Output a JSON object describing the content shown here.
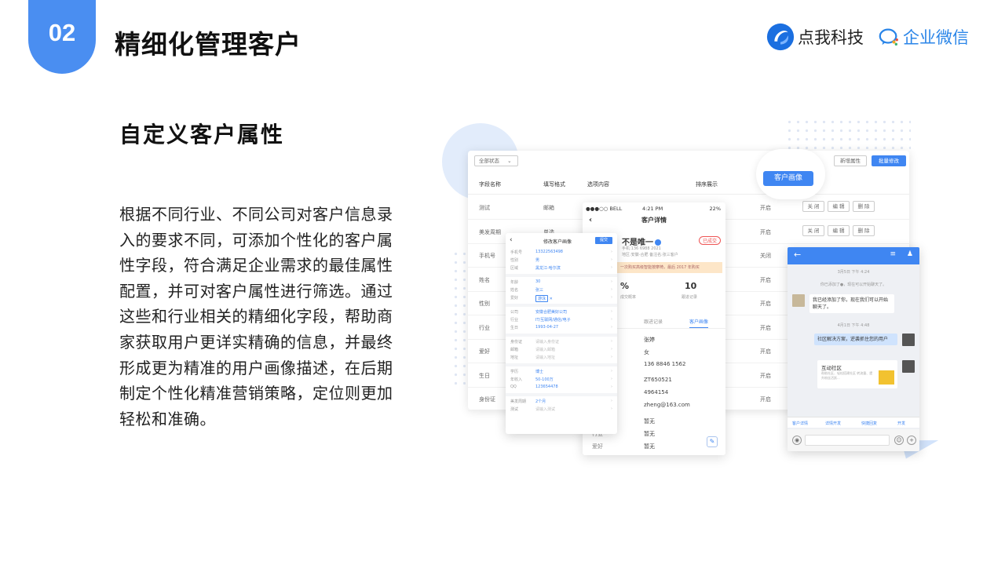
{
  "header": {
    "section_number": "02",
    "title": "精细化管理客户",
    "brand_name": "点我科技",
    "partner_name": "企业微信"
  },
  "content": {
    "subtitle": "自定义客户属性",
    "paragraph_lines": [
      "根据不同行业、不同公司对客户信息录",
      "入的要求不同，可添加个性化的客户属",
      "性字段，符合满足企业需求的最佳属性",
      "配置，并可对客户属性进行筛选。通过",
      "这些和行业相关的精细化字段，帮助商",
      "家获取用户更详实精确的信息，并最终",
      "形成更为精准的用户画像描述，在后期",
      "制定个性化精准营销策略，定位则更加",
      "轻松和准确。"
    ]
  },
  "table_panel": {
    "filter_select": "全部状态",
    "new_attr_button": "新增属性",
    "batch_edit_button": "批量修改",
    "columns": [
      "字段名称",
      "填写格式",
      "选项内容",
      "排序展示"
    ],
    "rows": [
      {
        "name": "测试",
        "format": "邮箱",
        "status": "开启",
        "actions": [
          "关 闭",
          "编 辑",
          "删 除"
        ]
      },
      {
        "name": "美发周期",
        "format": "单选",
        "status": "开启",
        "actions": [
          "关 闭",
          "编 辑",
          "删 除"
        ]
      },
      {
        "name": "手机号",
        "format": "",
        "status": "关闭",
        "actions": []
      },
      {
        "name": "姓名",
        "format": "",
        "status": "开启",
        "actions": []
      },
      {
        "name": "性别",
        "format": "",
        "status": "开启",
        "actions": []
      },
      {
        "name": "行业",
        "format": "",
        "status": "开启",
        "actions": []
      },
      {
        "name": "爱好",
        "format": "",
        "status": "开启",
        "actions": []
      },
      {
        "name": "生日",
        "format": "",
        "status": "开启",
        "actions": []
      },
      {
        "name": "身份证",
        "format": "",
        "status": "开启",
        "actions": []
      }
    ]
  },
  "portrait_bubble": {
    "label": "客户画像"
  },
  "phone_detail": {
    "carrier": "●●●○○ BELL",
    "time": "4:21 PM",
    "battery": "22%",
    "nav_title": "客户详情",
    "customer_name": "不是唯一",
    "tag": "已成交",
    "sub_line1": "手机:136 6988 2021",
    "sub_line2": "地区:安徽-合肥  备注名:张三客户",
    "note": "一次购买高级智能按摩椅，最后 2017 年购买",
    "stat1_value": "%",
    "stat1_label": "成交概率",
    "stat2_value": "10",
    "stat2_label": "跟进记录",
    "tab_follow": "跟进记录",
    "tab_portrait": "客户画像",
    "values": [
      "张婷",
      "女",
      "136 8846 1562",
      "ZT650521",
      "4964154",
      "zheng@163.com",
      "暂无",
      "暂无",
      "暂无"
    ],
    "tail_labels": [
      "",
      "",
      "",
      "",
      "",
      "",
      "",
      "行业",
      "爱好"
    ]
  },
  "edit_form": {
    "title": "修改客户画像",
    "submit": "提交",
    "sections": [
      [
        {
          "k": "手机号",
          "v": "13322563498"
        },
        {
          "k": "性别",
          "v": "男"
        },
        {
          "k": "区域",
          "v": "黑龙江-哈尔滨"
        }
      ],
      [
        {
          "k": "年龄",
          "v": "30"
        },
        {
          "k": "姓名",
          "v": "张三"
        },
        {
          "k": "爱好",
          "v": "游泳",
          "chip": true
        }
      ],
      [
        {
          "k": "公司",
          "v": "安徽合肥美好公司"
        },
        {
          "k": "行业",
          "v": "IT/互联网/通信/电子"
        },
        {
          "k": "生日",
          "v": "1993-04-27"
        }
      ],
      [
        {
          "k": "身份证",
          "v": "请输入身份证",
          "gray": true
        },
        {
          "k": "邮箱",
          "v": "请输入邮箱",
          "gray": true
        },
        {
          "k": "地址",
          "v": "请输入地址",
          "gray": true
        }
      ],
      [
        {
          "k": "学历",
          "v": "博士"
        },
        {
          "k": "年收入",
          "v": "50-100万"
        },
        {
          "k": "QQ",
          "v": "123654478"
        }
      ],
      [
        {
          "k": "美发周期",
          "v": "2个月"
        },
        {
          "k": "测试",
          "v": "请输入测试",
          "gray": true
        }
      ]
    ]
  },
  "chat": {
    "time1": "3月5日 下午 4:24",
    "system_line": "你已添加了●，现在可以开始聊天了。",
    "msg_left": "我已经添加了你，现在我们可以开始聊天了。",
    "time2": "4月1日 下午 4:48",
    "msg_right": "社区解决方案，逆袭抓住您的用户",
    "card_title": "互动社区",
    "card_desc": "帮助社区、轻松搭建社区 转流量、提升粉丝活跃...",
    "bar_items": [
      "客户详情",
      "详情开发",
      "快捷回复",
      "开发"
    ]
  },
  "colors": {
    "accent": "#4a8ef1",
    "button_blue": "#3f86f2",
    "wework_blue": "#2a85e8"
  }
}
